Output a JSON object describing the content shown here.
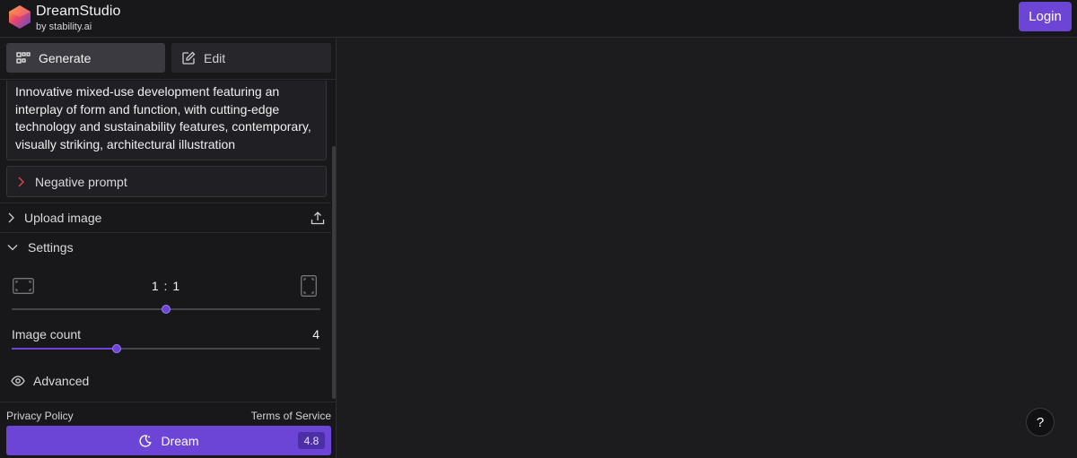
{
  "header": {
    "brand_name": "DreamStudio",
    "brand_sub": "by stability.ai",
    "login_label": "Login",
    "accent": "#6d45d6"
  },
  "tabs": [
    {
      "label": "Generate",
      "icon": "grid-icon",
      "active": true
    },
    {
      "label": "Edit",
      "icon": "edit-icon",
      "active": false
    }
  ],
  "prompt": {
    "text": "Innovative mixed-use development featuring an interplay of form and function, with cutting-edge technology and sustainability features, contemporary, visually striking, architectural illustration"
  },
  "negative_prompt": {
    "label": "Negative prompt"
  },
  "upload": {
    "label": "Upload image"
  },
  "settings": {
    "label": "Settings",
    "aspect_ratio": {
      "label": "1 : 1",
      "slider_value": 0.5
    },
    "image_count": {
      "label": "Image count",
      "value": "4",
      "slider_value": 0.34
    },
    "advanced_label": "Advanced"
  },
  "footer": {
    "privacy": "Privacy Policy",
    "terms": "Terms of Service",
    "dream_label": "Dream",
    "credits": "4.8"
  },
  "help": {
    "label": "?"
  }
}
